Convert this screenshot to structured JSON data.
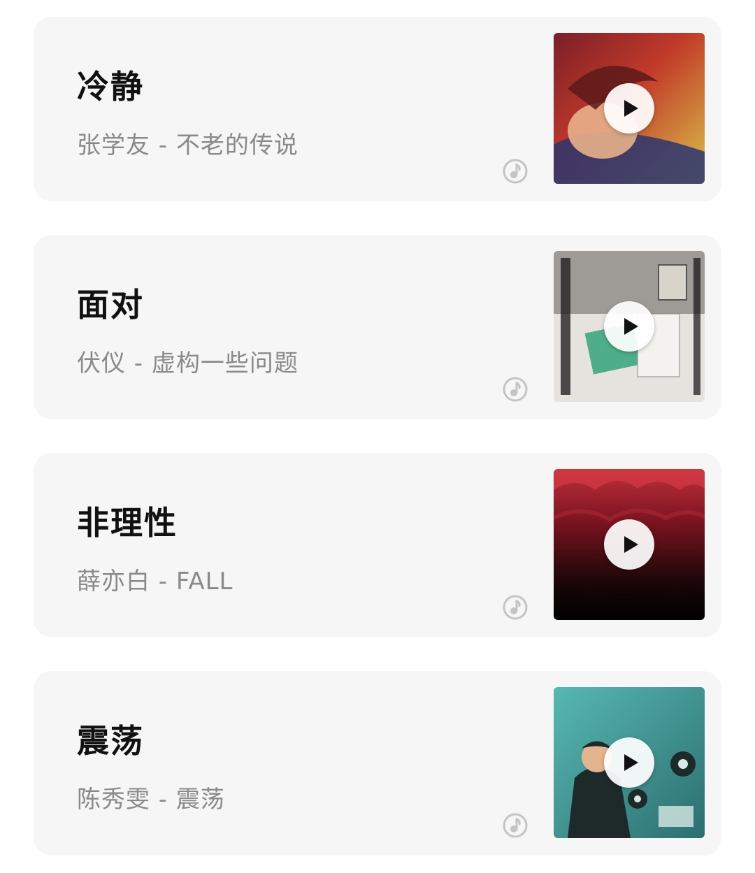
{
  "songs": [
    {
      "title": "冷静",
      "meta": "张学友 - 不老的传说",
      "icon": "music-app-icon",
      "cover_colors": [
        "#a32a2a",
        "#e0a050",
        "#2a3570",
        "#d8c040"
      ]
    },
    {
      "title": "面对",
      "meta": "伏仪 - 虚构一些问题",
      "icon": "music-app-icon",
      "cover_colors": [
        "#e6e3de",
        "#2b2b2b",
        "#4fae8a",
        "#b9b3a8"
      ]
    },
    {
      "title": "非理性",
      "meta": "薛亦白 - FALL",
      "icon": "music-app-icon",
      "cover_colors": [
        "#c0303a",
        "#7a1420",
        "#1a0608",
        "#000000"
      ]
    },
    {
      "title": "震荡",
      "meta": "陈秀雯 - 震荡",
      "icon": "music-app-icon",
      "cover_colors": [
        "#3fa6a2",
        "#1e2a2a",
        "#d8e8e4",
        "#2c6f70"
      ]
    }
  ],
  "play_icon": "play-icon"
}
